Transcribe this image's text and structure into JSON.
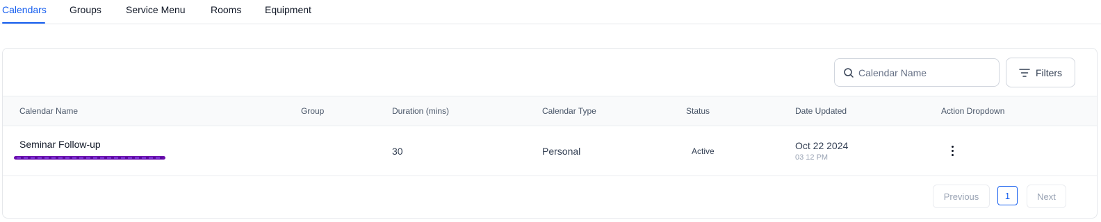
{
  "tabs": [
    {
      "label": "Calendars",
      "active": true
    },
    {
      "label": "Groups",
      "active": false
    },
    {
      "label": "Service Menu",
      "active": false
    },
    {
      "label": "Rooms",
      "active": false
    },
    {
      "label": "Equipment",
      "active": false
    }
  ],
  "toolbar": {
    "search_placeholder": "Calendar Name",
    "search_value": "",
    "search_icon": "search-icon",
    "filters_label": "Filters",
    "filters_icon": "filter-lines-icon"
  },
  "table": {
    "columns": [
      "Calendar Name",
      "Group",
      "Duration (mins)",
      "Calendar Type",
      "Status",
      "Date Updated",
      "Action Dropdown"
    ],
    "rows": [
      {
        "calendar_name": "Seminar Follow-up",
        "group": "",
        "duration": "30",
        "calendar_type": "Personal",
        "status": "Active",
        "date_updated": "Oct 22 2024",
        "time_updated": "03 12 PM",
        "action_icon": "kebab-menu-icon"
      }
    ]
  },
  "pagination": {
    "previous_label": "Previous",
    "current_page": "1",
    "next_label": "Next"
  },
  "colors": {
    "accent": "#155eef",
    "redaction": "#6a0dad"
  }
}
